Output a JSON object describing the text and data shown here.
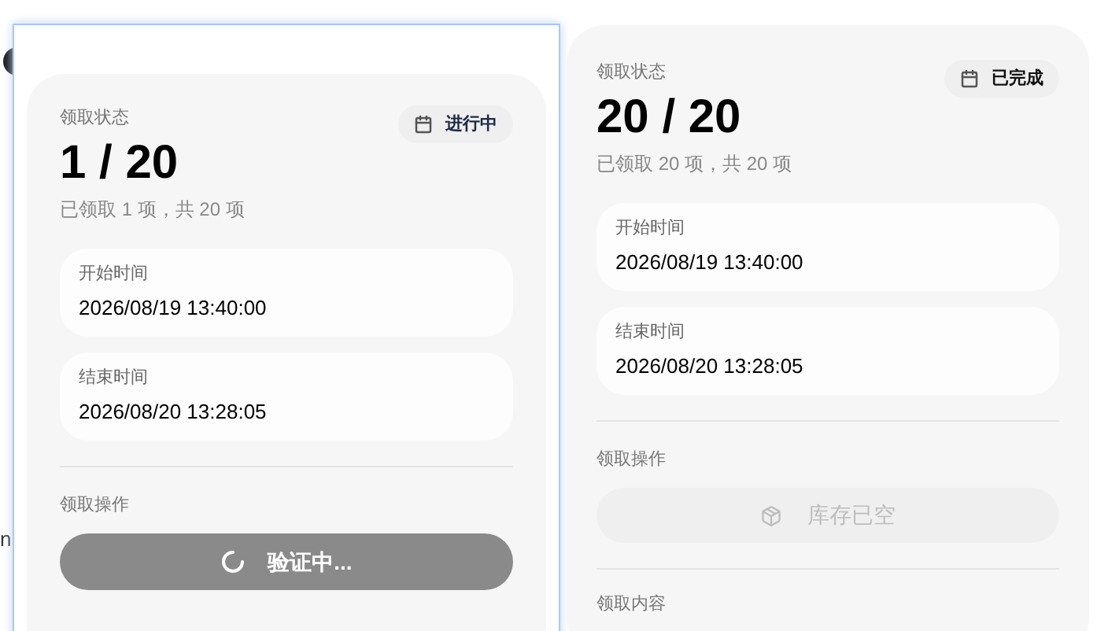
{
  "background": {
    "fragment": "n"
  },
  "panels": [
    {
      "status_label": "领取状态",
      "badge": {
        "kind": "active",
        "label": "进行中"
      },
      "count": "1 / 20",
      "summary": "已领取 1 项，共 20 项",
      "times": [
        {
          "label": "开始时间",
          "value": "2026/08/19 13:40:00"
        },
        {
          "label": "结束时间",
          "value": "2026/08/20 13:28:05"
        }
      ],
      "action_label": "领取操作",
      "action": {
        "kind": "loading",
        "label": "验证中..."
      }
    },
    {
      "status_label": "领取状态",
      "badge": {
        "kind": "done",
        "label": "已完成"
      },
      "count": "20 / 20",
      "summary": "已领取 20 项，共 20 项",
      "times": [
        {
          "label": "开始时间",
          "value": "2026/08/19 13:40:00"
        },
        {
          "label": "结束时间",
          "value": "2026/08/20 13:28:05"
        }
      ],
      "action_label": "领取操作",
      "action": {
        "kind": "empty",
        "label": "库存已空"
      },
      "content_label": "领取内容"
    }
  ]
}
